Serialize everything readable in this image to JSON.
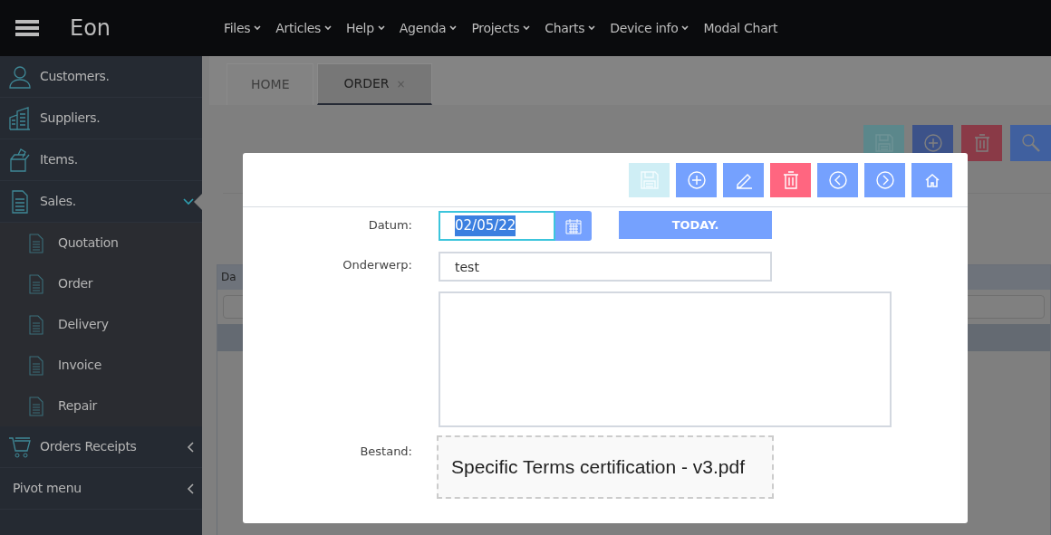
{
  "navbar": {
    "brand": "Eon",
    "menu": [
      {
        "label": "Files",
        "dropdown": true
      },
      {
        "label": "Articles",
        "dropdown": true
      },
      {
        "label": "Help",
        "dropdown": true
      },
      {
        "label": "Agenda",
        "dropdown": true
      },
      {
        "label": "Projects",
        "dropdown": true
      },
      {
        "label": "Charts",
        "dropdown": true
      },
      {
        "label": "Device info",
        "dropdown": true
      },
      {
        "label": "Modal Chart",
        "dropdown": false
      }
    ]
  },
  "sidebar": {
    "items": [
      {
        "label": "Customers."
      },
      {
        "label": "Suppliers."
      },
      {
        "label": "Items."
      },
      {
        "label": "Sales.",
        "expanded": true,
        "children": [
          {
            "label": "Quotation"
          },
          {
            "label": "Order"
          },
          {
            "label": "Delivery"
          },
          {
            "label": "Invoice"
          },
          {
            "label": "Repair"
          }
        ]
      },
      {
        "label": "Orders Receipts",
        "expanded": false
      },
      {
        "label": "Pivot menu",
        "expanded": false
      }
    ]
  },
  "tabs": [
    {
      "label": "HOME",
      "selected": false,
      "closable": false
    },
    {
      "label": "ORDER",
      "selected": true,
      "closable": true,
      "close": "×"
    }
  ],
  "background_toolbar": [
    {
      "kind": "save",
      "disabled": true
    },
    {
      "kind": "add",
      "disabled": false
    },
    {
      "kind": "delete",
      "disabled": false
    },
    {
      "kind": "search",
      "disabled": false
    }
  ],
  "background_grid": {
    "column_1": "Da"
  },
  "modal": {
    "toolbar": [
      {
        "kind": "save",
        "disabled": true
      },
      {
        "kind": "add",
        "disabled": false
      },
      {
        "kind": "edit",
        "disabled": false
      },
      {
        "kind": "delete",
        "disabled": false
      },
      {
        "kind": "previous",
        "disabled": false
      },
      {
        "kind": "next",
        "disabled": false
      },
      {
        "kind": "home",
        "disabled": false
      }
    ],
    "datum": {
      "label": "Datum:",
      "value": "02/05/22",
      "text_selected": true,
      "focused": true
    },
    "today_button": "TODAY.",
    "onderwerp": {
      "label": "Onderwerp:",
      "value": "test"
    },
    "bestand": {
      "label": "Bestand:",
      "file": "Specific Terms certification - v3.pdf"
    }
  }
}
